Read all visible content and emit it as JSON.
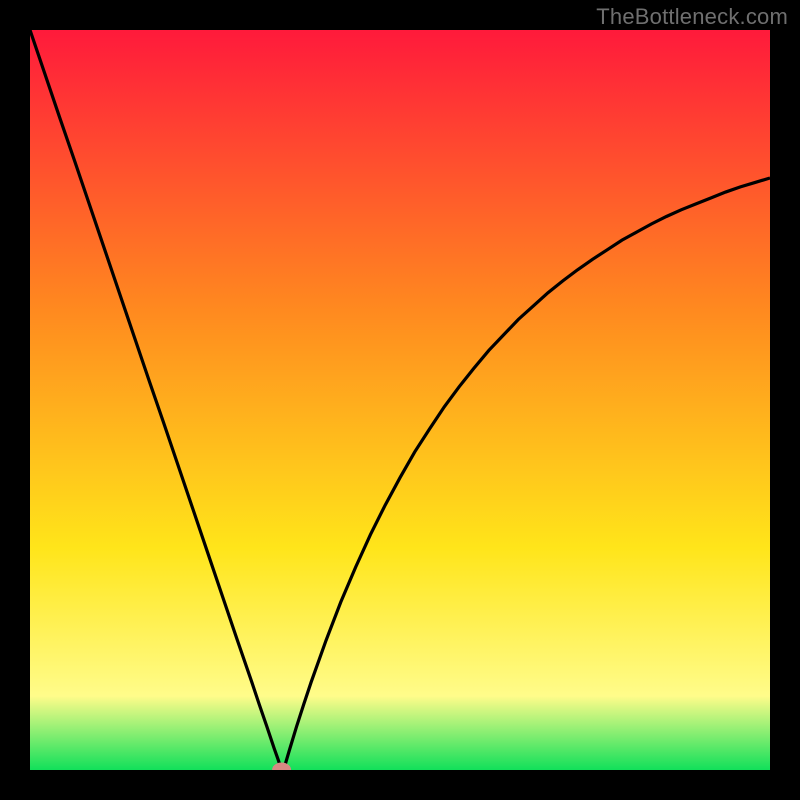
{
  "watermark": "TheBottleneck.com",
  "colors": {
    "frame": "#000000",
    "gradient_top": "#ff1a3b",
    "gradient_mid1": "#ff8a1f",
    "gradient_mid2": "#ffe51a",
    "gradient_low": "#fffc8a",
    "gradient_bottom": "#11e05a",
    "curve": "#000000",
    "marker_fill": "#d68a83",
    "marker_stroke": "#d68a83"
  },
  "chart_data": {
    "type": "line",
    "title": "",
    "xlabel": "",
    "ylabel": "",
    "xlim": [
      0,
      100
    ],
    "ylim": [
      0,
      100
    ],
    "x": [
      0,
      2,
      4,
      6,
      8,
      10,
      12,
      14,
      16,
      18,
      20,
      22,
      24,
      26,
      28,
      30,
      31,
      32,
      33,
      33.5,
      34,
      34.5,
      35,
      36,
      37,
      38,
      40,
      42,
      44,
      46,
      48,
      50,
      52,
      54,
      56,
      58,
      60,
      62,
      64,
      66,
      68,
      70,
      72,
      74,
      76,
      78,
      80,
      82,
      84,
      86,
      88,
      90,
      92,
      94,
      96,
      98,
      100
    ],
    "values": [
      100,
      94.1,
      88.2,
      82.4,
      76.5,
      70.6,
      64.7,
      58.8,
      52.9,
      47.1,
      41.2,
      35.3,
      29.4,
      23.5,
      17.6,
      11.8,
      8.8,
      5.9,
      2.9,
      1.5,
      0.0,
      0.8,
      2.5,
      5.8,
      8.9,
      11.9,
      17.5,
      22.7,
      27.4,
      31.8,
      35.8,
      39.5,
      43.0,
      46.1,
      49.1,
      51.8,
      54.3,
      56.7,
      58.8,
      60.9,
      62.7,
      64.5,
      66.1,
      67.6,
      69.0,
      70.3,
      71.6,
      72.7,
      73.8,
      74.8,
      75.7,
      76.5,
      77.3,
      78.1,
      78.8,
      79.4,
      80.0
    ],
    "marker": {
      "x": 34,
      "y": 0
    }
  }
}
